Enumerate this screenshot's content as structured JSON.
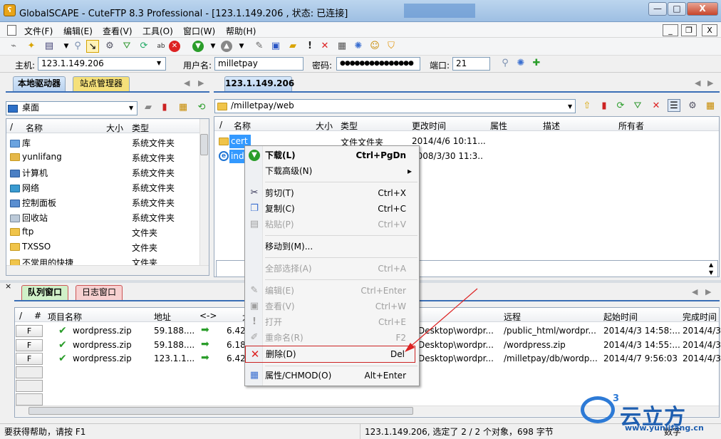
{
  "window": {
    "title": "GlobalSCAPE - CuteFTP 8.3 Professional - [123.1.149.206 , 状态: 已连接]",
    "minimize": "—",
    "maximize": "□",
    "close": "X"
  },
  "menu": {
    "items": [
      "文件(F)",
      "编辑(E)",
      "查看(V)",
      "工具(O)",
      "窗口(W)",
      "帮助(H)"
    ],
    "mdi_min": "_",
    "mdi_restore": "❐",
    "mdi_close": "X"
  },
  "connection": {
    "host_label": "主机:",
    "host_value": "123.1.149.206",
    "user_label": "用户名:",
    "user_value": "milletpay",
    "pass_label": "密码:",
    "pass_value": "●●●●●●●●●●●●●●●",
    "port_label": "端口:",
    "port_value": "21"
  },
  "left_panel": {
    "tabs": [
      "本地驱动器",
      "站点管理器"
    ],
    "location": "桌面",
    "columns": [
      "/",
      "名称",
      "大小",
      "类型"
    ],
    "rows": [
      {
        "name": "库",
        "type": "系统文件夹"
      },
      {
        "name": "yunlifang",
        "type": "系统文件夹"
      },
      {
        "name": "计算机",
        "type": "系统文件夹"
      },
      {
        "name": "网络",
        "type": "系统文件夹"
      },
      {
        "name": "控制面板",
        "type": "系统文件夹"
      },
      {
        "name": "回收站",
        "type": "系统文件夹"
      },
      {
        "name": "ftp",
        "type": "文件夹"
      },
      {
        "name": "TXSSO",
        "type": "文件夹"
      },
      {
        "name": "不常用的快捷",
        "type": "文件夹"
      }
    ]
  },
  "right_panel": {
    "tab": "123.1.149.206",
    "path": "/milletpay/web",
    "columns": [
      "/",
      "名称",
      "大小",
      "类型",
      "更改时间",
      "属性",
      "描述",
      "所有者"
    ],
    "rows": [
      {
        "name": "cert",
        "type": "文件文件夹",
        "modified": "2014/4/6 10:11..."
      },
      {
        "name": "inde",
        "type": "",
        "modified": "2008/3/30 11:3..."
      }
    ],
    "log_snippet": "..."
  },
  "context_menu": {
    "items": [
      {
        "label": "下载(L)",
        "shortcut": "Ctrl+PgDn",
        "icon": "download-icon",
        "bold": true,
        "disabled": false
      },
      {
        "label": "下载高级(N)",
        "shortcut": "▸",
        "icon": "",
        "disabled": false
      },
      {
        "label": "剪切(T)",
        "shortcut": "Ctrl+X",
        "icon": "scissors-icon",
        "disabled": false
      },
      {
        "label": "复制(C)",
        "shortcut": "Ctrl+C",
        "icon": "copy-icon",
        "disabled": false
      },
      {
        "label": "粘贴(P)",
        "shortcut": "Ctrl+V",
        "icon": "paste-icon",
        "disabled": true
      },
      {
        "label": "移动到(M)...",
        "shortcut": "",
        "icon": "",
        "disabled": false
      },
      {
        "label": "全部选择(A)",
        "shortcut": "Ctrl+A",
        "icon": "",
        "disabled": true
      },
      {
        "label": "编辑(E)",
        "shortcut": "Ctrl+Enter",
        "icon": "edit-icon",
        "disabled": true
      },
      {
        "label": "查看(V)",
        "shortcut": "Ctrl+W",
        "icon": "view-icon",
        "disabled": true
      },
      {
        "label": "打开",
        "shortcut": "Ctrl+E",
        "icon": "open-icon",
        "disabled": true
      },
      {
        "label": "重命名(R)",
        "shortcut": "F2",
        "icon": "rename-icon",
        "disabled": true
      },
      {
        "label": "删除(D)",
        "shortcut": "Del",
        "icon": "delete-icon",
        "disabled": false
      },
      {
        "label": "属性/CHMOD(O)",
        "shortcut": "Alt+Enter",
        "icon": "properties-icon",
        "disabled": false
      }
    ]
  },
  "queue": {
    "tabs": [
      "队列窗口",
      "日志窗口"
    ],
    "columns": [
      "/",
      "#",
      "项目名称",
      "地址",
      "<->",
      "大",
      "远程",
      "起始时间",
      "完成时间"
    ],
    "rows": [
      {
        "btn": "F",
        "name": "wordpress.zip",
        "address": "59.188....",
        "size": "6.42",
        "local": "Desktop\\wordpr...",
        "remote": "/public_html/wordpr...",
        "start": "2014/4/3 14:58:...",
        "end": "2014/4/3"
      },
      {
        "btn": "F",
        "name": "wordpress.zip",
        "address": "59.188....",
        "size": "6.18",
        "local": "Desktop\\wordpr...",
        "remote": "/wordpress.zip",
        "start": "2014/4/3 14:55:...",
        "end": "2014/4/3"
      },
      {
        "btn": "F",
        "name": "wordpress.zip",
        "address": "123.1.1...",
        "size": "6.42",
        "local": "Desktop\\wordpr...",
        "remote": "/milletpay/db/wordp...",
        "start": "2014/4/7 9:56:03",
        "end": "2014/4/3"
      }
    ]
  },
  "status": {
    "left": "要获得帮助，请按 F1",
    "right": "123.1.149.206, 选定了 2 / 2 个对象，698 字节",
    "num": "数字"
  },
  "watermark": {
    "brand": "云立方",
    "url": "www.yunlifang.cn"
  },
  "colors": {
    "selection": "#3399ff",
    "delete_highlight": "#cc2222",
    "annotation_arrow": "#dd2222"
  }
}
